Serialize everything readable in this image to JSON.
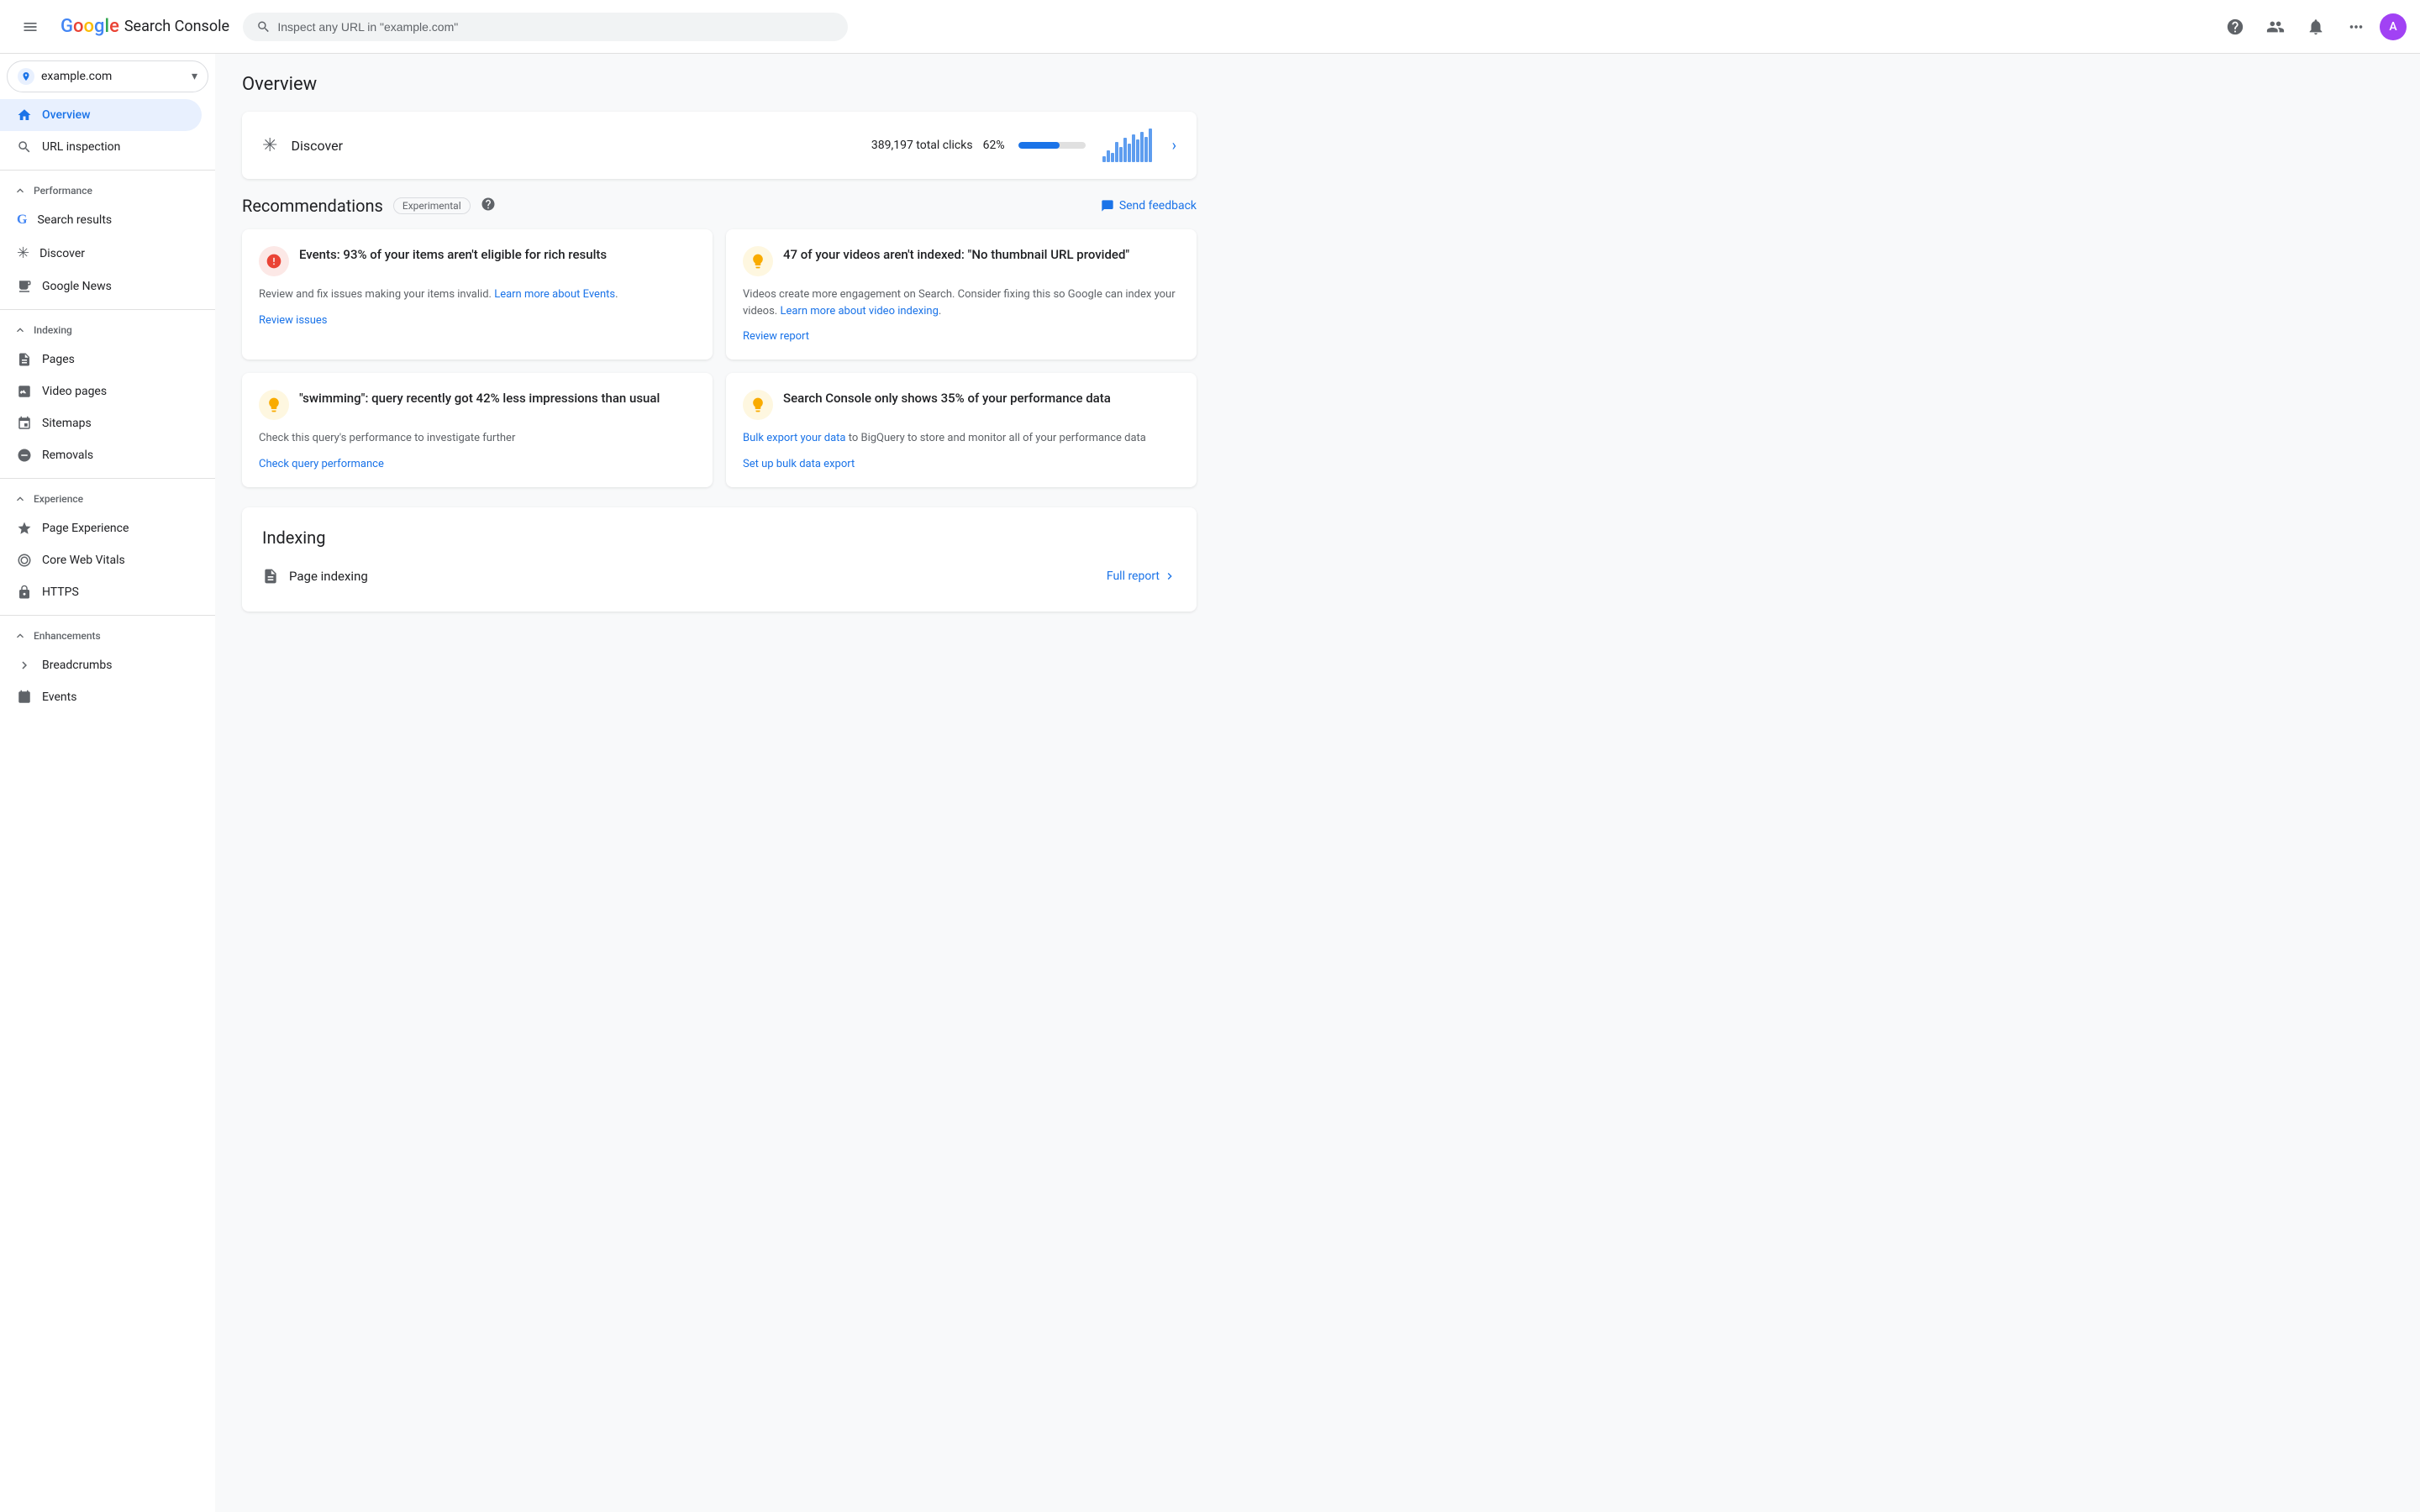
{
  "topbar": {
    "menu_label": "☰",
    "logo_g": "G",
    "logo_oogle": "oogle",
    "app_name": "Search Console",
    "search_placeholder": "Inspect any URL in \"example.com\"",
    "help_icon": "?",
    "people_icon": "👤",
    "bell_icon": "🔔",
    "grid_icon": "⋮⋮⋮",
    "avatar_text": "A"
  },
  "sidebar": {
    "property_name": "example.com",
    "nav_items": [
      {
        "label": "Overview",
        "icon": "🏠",
        "active": true,
        "id": "overview"
      },
      {
        "label": "URL inspection",
        "icon": "🔍",
        "active": false,
        "id": "url-inspection"
      }
    ],
    "sections": [
      {
        "label": "Performance",
        "items": [
          {
            "label": "Search results",
            "icon": "G",
            "id": "search-results"
          },
          {
            "label": "Discover",
            "icon": "✳",
            "id": "discover"
          },
          {
            "label": "Google News",
            "icon": "▦",
            "id": "google-news"
          }
        ]
      },
      {
        "label": "Indexing",
        "items": [
          {
            "label": "Pages",
            "icon": "📄",
            "id": "pages"
          },
          {
            "label": "Video pages",
            "icon": "▣",
            "id": "video-pages"
          },
          {
            "label": "Sitemaps",
            "icon": "⊞",
            "id": "sitemaps"
          },
          {
            "label": "Removals",
            "icon": "⊘",
            "id": "removals"
          }
        ]
      },
      {
        "label": "Experience",
        "items": [
          {
            "label": "Page Experience",
            "icon": "⬡",
            "id": "page-experience"
          },
          {
            "label": "Core Web Vitals",
            "icon": "◎",
            "id": "core-web-vitals"
          },
          {
            "label": "HTTPS",
            "icon": "🔒",
            "id": "https"
          }
        ]
      },
      {
        "label": "Enhancements",
        "items": [
          {
            "label": "Breadcrumbs",
            "icon": "⟩⟩",
            "id": "breadcrumbs"
          },
          {
            "label": "Events",
            "icon": "◈",
            "id": "events"
          }
        ]
      }
    ]
  },
  "overview": {
    "title": "Overview",
    "discover_card": {
      "icon": "✳",
      "label": "Discover",
      "total_clicks": "389,197 total clicks",
      "percentage": "62%",
      "progress": 62,
      "arrow": "›",
      "chart_bars": [
        10,
        20,
        15,
        35,
        25,
        40,
        30,
        45,
        38,
        50,
        42,
        55
      ]
    },
    "recommendations": {
      "title": "Recommendations",
      "badge": "Experimental",
      "send_feedback": "Send feedback",
      "cards": [
        {
          "id": "events-card",
          "icon_type": "error",
          "icon": "⚠",
          "title": "Events: 93% of your items aren't eligible for rich results",
          "description": "Review and fix issues making your items invalid.",
          "link_text": "Learn more about Events",
          "action_text": "Review issues",
          "action_href": "#"
        },
        {
          "id": "video-card",
          "icon_type": "info",
          "icon": "💡",
          "title": "47 of your videos aren't indexed: \"No thumbnail URL provided\"",
          "description": "Videos create more engagement on Search. Consider fixing this so Google can index your videos.",
          "link_text": "Learn more about video indexing",
          "action_text": "Review report",
          "action_href": "#"
        },
        {
          "id": "swimming-card",
          "icon_type": "info",
          "icon": "💡",
          "title": "\"swimming\": query recently got 42% less impressions than usual",
          "description": "Check this query's performance to investigate further",
          "link_text": "",
          "action_text": "Check query performance",
          "action_href": "#"
        },
        {
          "id": "bulk-export-card",
          "icon_type": "info",
          "icon": "💡",
          "title": "Search Console only shows 35% of your performance data",
          "description": "to BigQuery to store and monitor all of your performance data",
          "link_text": "Bulk export your data",
          "action_text": "Set up bulk data export",
          "action_href": "#"
        }
      ]
    },
    "indexing": {
      "title": "Indexing",
      "page_indexing_label": "Page indexing",
      "full_report": "Full report",
      "page_indexing_icon": "📄"
    }
  }
}
